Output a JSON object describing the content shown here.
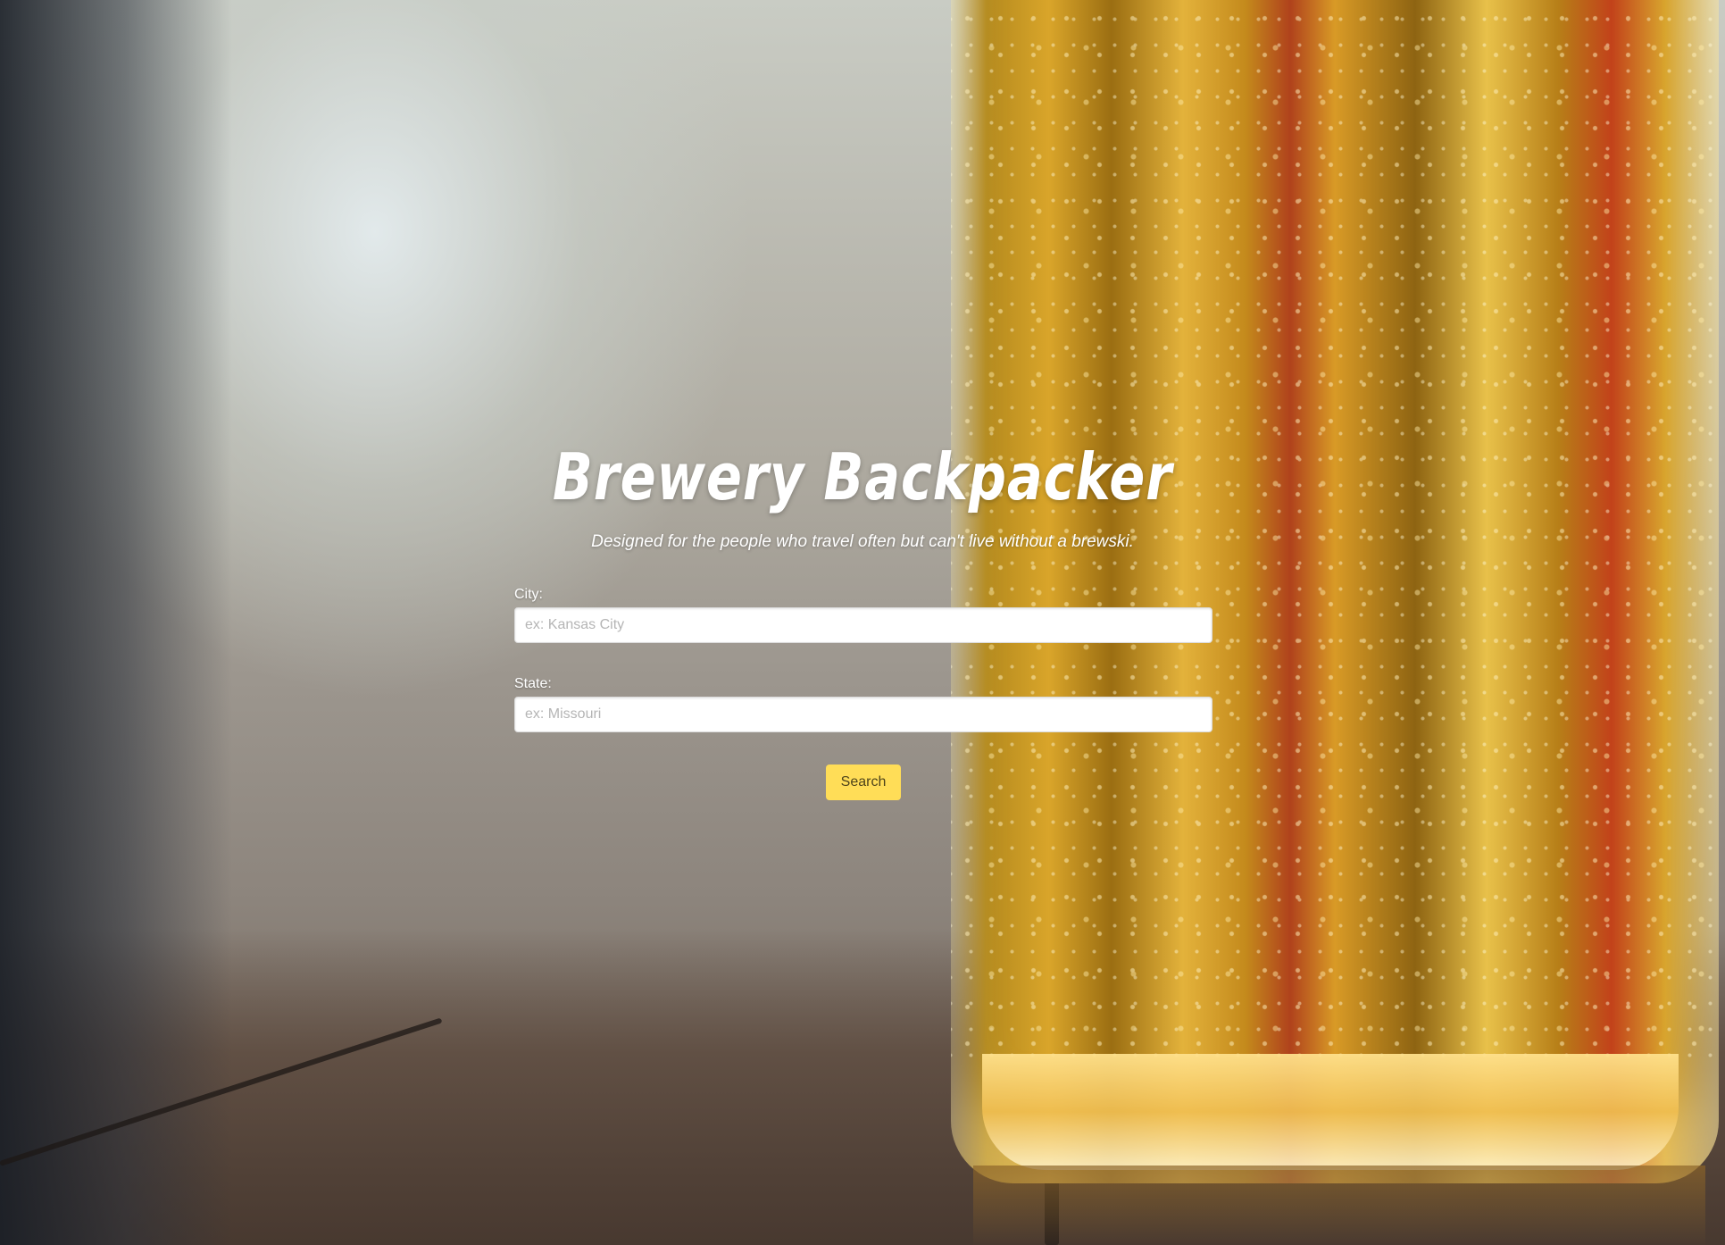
{
  "hero": {
    "title": "Brewery Backpacker",
    "tagline": "Designed for the people who travel often but can't live without a brewski."
  },
  "form": {
    "city": {
      "label": "City:",
      "placeholder": "ex: Kansas City",
      "value": ""
    },
    "state": {
      "label": "State:",
      "placeholder": "ex: Missouri",
      "value": ""
    },
    "search_label": "Search"
  },
  "colors": {
    "button": "#ffdd57",
    "text": "#ffffff"
  }
}
